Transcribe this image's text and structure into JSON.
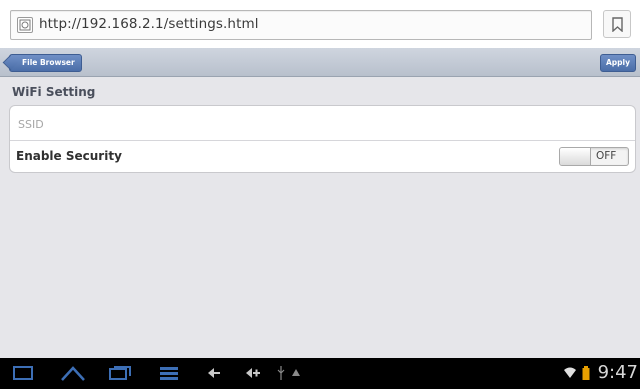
{
  "browser": {
    "url": "http://192.168.2.1/settings.html"
  },
  "navbar": {
    "back_label": "File Browser",
    "apply_label": "Apply"
  },
  "settings": {
    "section_title": "WiFi Setting",
    "ssid_placeholder": "SSID",
    "ssid_value": "",
    "security_label": "Enable Security",
    "security_toggle": "OFF"
  },
  "statusbar": {
    "time": "9:47",
    "icons": [
      "back-icon",
      "home-icon",
      "recent-apps-icon",
      "menu-icon",
      "volume-down-icon",
      "volume-up-icon",
      "usb-icon",
      "notification-icon",
      "wifi-icon",
      "battery-icon"
    ]
  },
  "colors": {
    "nav_button": "#4b6ea8",
    "status_bar": "#000000",
    "status_icon": "#3d6fb6"
  }
}
